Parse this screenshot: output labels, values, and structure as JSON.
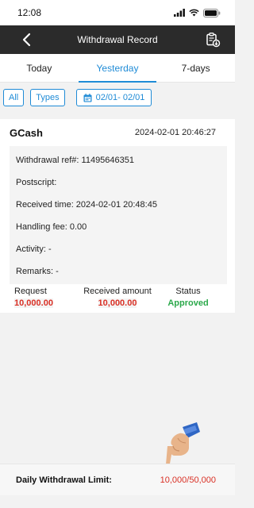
{
  "status_bar": {
    "time": "12:08"
  },
  "header": {
    "title": "Withdrawal Record"
  },
  "tabs": [
    {
      "label": "Today",
      "active": false
    },
    {
      "label": "Yesterday",
      "active": true
    },
    {
      "label": "7-days",
      "active": false
    }
  ],
  "filters": {
    "all_label": "All",
    "types_label": "Types",
    "date_range": "02/01- 02/01"
  },
  "record": {
    "channel": "GCash",
    "datetime": "2024-02-01 20:46:27",
    "details": {
      "ref": "Withdrawal ref#:  11495646351",
      "postscript": "Postscript:",
      "received_time": "Received time:  2024-02-01 20:48:45",
      "handling_fee": "Handling fee:  0.00",
      "activity": "Activity:  -",
      "remarks": "Remarks:  -"
    },
    "summary_headers": {
      "request": "Request",
      "received": "Received amount",
      "status": "Status"
    },
    "summary_values": {
      "request": "10,000.00",
      "received": "10,000.00",
      "status": "Approved"
    }
  },
  "footer": {
    "label": "Daily Withdrawal Limit:",
    "value": "10,000/50,000"
  },
  "colors": {
    "accent": "#1f8bd6",
    "header_bg": "#2b2b2b",
    "amount_red": "#d93025",
    "approved_green": "#2aa84a"
  }
}
